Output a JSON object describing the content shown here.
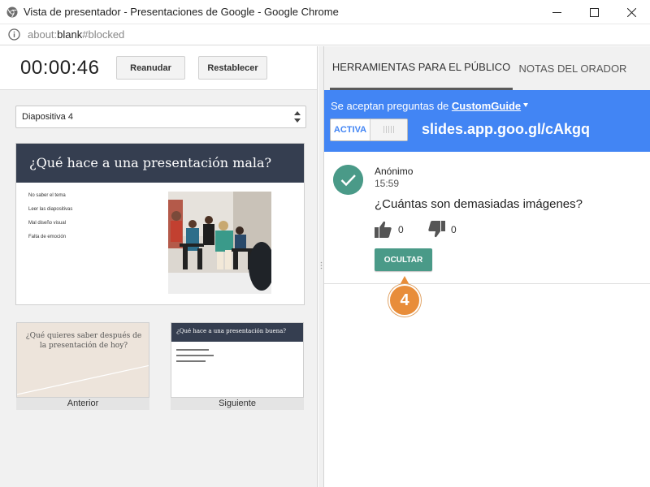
{
  "window": {
    "title": "Vista de presentador - Presentaciones de Google - Google Chrome",
    "url_prefix": "about:",
    "url_main": "blank",
    "url_suffix": "#blocked"
  },
  "timer": {
    "elapsed": "00:00:46",
    "resume_label": "Reanudar",
    "reset_label": "Restablecer"
  },
  "slide_selector": {
    "value": "Diapositiva 4"
  },
  "current_slide": {
    "title": "¿Qué hace a una presentación mala?",
    "bullets": [
      "No saber el tema",
      "Leer las diapositivas",
      "Mal diseño visual",
      "Falta de emoción"
    ]
  },
  "previous_slide": {
    "text": "¿Qué quieres saber después de la presentación de hoy?",
    "label": "Anterior"
  },
  "next_slide": {
    "title": "¿Qué hace a una presentación buena?",
    "label": "Siguiente"
  },
  "tabs": [
    {
      "label": "HERRAMIENTAS PARA EL PÚBLICO",
      "active": true
    },
    {
      "label": "NOTAS DEL ORADOR",
      "active": false
    }
  ],
  "qa": {
    "accepting_prefix": "Se aceptan preguntas de",
    "accepting_org": "CustomGuide",
    "toggle_on_label": "ACTIVA",
    "link": "slides.app.goo.gl/cAkgq"
  },
  "question": {
    "author": "Anónimo",
    "time": "15:59",
    "text": "¿Cuántas son demasiadas imágenes?",
    "upvotes": "0",
    "downvotes": "0",
    "hide_label": "OCULTAR"
  },
  "callout": {
    "number": "4"
  },
  "colors": {
    "accent_blue": "#4285f4",
    "slide_header": "#353e50",
    "teal": "#4a9a88",
    "callout_orange": "#e88d3a"
  }
}
